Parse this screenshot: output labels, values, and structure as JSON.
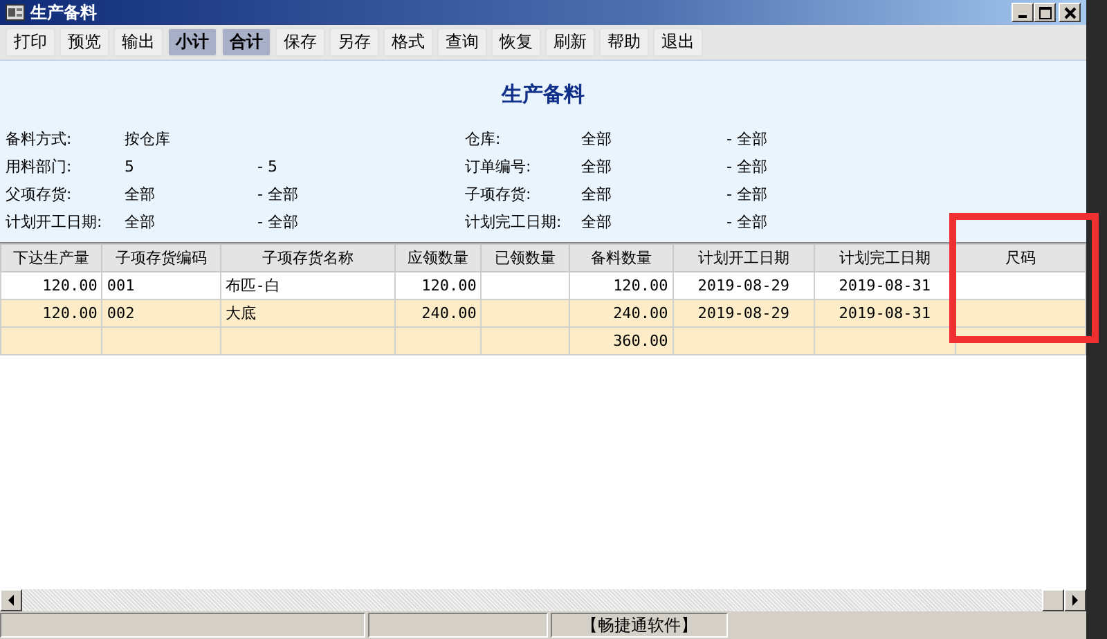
{
  "window": {
    "title": "生产备料"
  },
  "toolbar": [
    {
      "label": "打印",
      "selected": false
    },
    {
      "label": "预览",
      "selected": false
    },
    {
      "label": "输出",
      "selected": false
    },
    {
      "label": "小计",
      "selected": true
    },
    {
      "label": "合计",
      "selected": true
    },
    {
      "label": "保存",
      "selected": false
    },
    {
      "label": "另存",
      "selected": false
    },
    {
      "label": "格式",
      "selected": false
    },
    {
      "label": "查询",
      "selected": false
    },
    {
      "label": "恢复",
      "selected": false
    },
    {
      "label": "刷新",
      "selected": false
    },
    {
      "label": "帮助",
      "selected": false
    },
    {
      "label": "退出",
      "selected": false
    }
  ],
  "report": {
    "title": "生产备料",
    "filters": [
      {
        "label": "备料方式:",
        "from": "按仓库",
        "label2": "仓库:",
        "from2": "全部",
        "to2": "- 全部"
      },
      {
        "label": "用料部门:",
        "from": "5",
        "to": "- 5",
        "label2": "订单编号:",
        "from2": "全部",
        "to2": "- 全部"
      },
      {
        "label": "父项存货:",
        "from": "全部",
        "to": "- 全部",
        "label2": "子项存货:",
        "from2": "全部",
        "to2": "- 全部"
      },
      {
        "label": "计划开工日期:",
        "from": "全部",
        "to": "- 全部",
        "label2": "计划完工日期:",
        "from2": "全部",
        "to2": "- 全部"
      }
    ]
  },
  "table": {
    "columns": [
      "下达生产量",
      "子项存货编码",
      "子项存货名称",
      "应领数量",
      "已领数量",
      "备料数量",
      "计划开工日期",
      "计划完工日期",
      "尺码"
    ],
    "rows": [
      {
        "kind": "data",
        "cells": [
          "120.00",
          "001",
          "布匹-白",
          "120.00",
          "",
          "120.00",
          "2019-08-29",
          "2019-08-31",
          ""
        ]
      },
      {
        "kind": "data",
        "cells": [
          "120.00",
          "002",
          "大底",
          "240.00",
          "",
          "240.00",
          "2019-08-29",
          "2019-08-31",
          ""
        ]
      },
      {
        "kind": "total",
        "cells": [
          "",
          "",
          "",
          "",
          "",
          "360.00",
          "",
          "",
          ""
        ]
      }
    ]
  },
  "annotation": {
    "kind": "highlight",
    "color": "#f03030"
  },
  "status_bar": {
    "text": "【畅捷通软件】"
  }
}
